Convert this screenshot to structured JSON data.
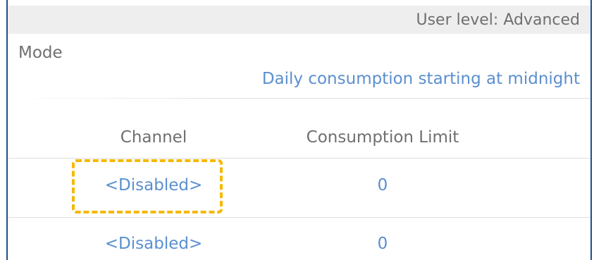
{
  "header": {
    "user_level": "User level: Advanced"
  },
  "mode": {
    "label": "Mode",
    "value": "Daily consumption starting at midnight"
  },
  "table": {
    "columns": [
      "Channel",
      "Consumption Limit"
    ],
    "rows": [
      {
        "channel": "<Disabled>",
        "limit": "0"
      },
      {
        "channel": "<Disabled>",
        "limit": "0"
      }
    ]
  },
  "colors": {
    "link": "#5b8fcf",
    "label": "#6f6f6f",
    "highlight": "#f5b800",
    "frame_border": "#1f4e8c"
  }
}
